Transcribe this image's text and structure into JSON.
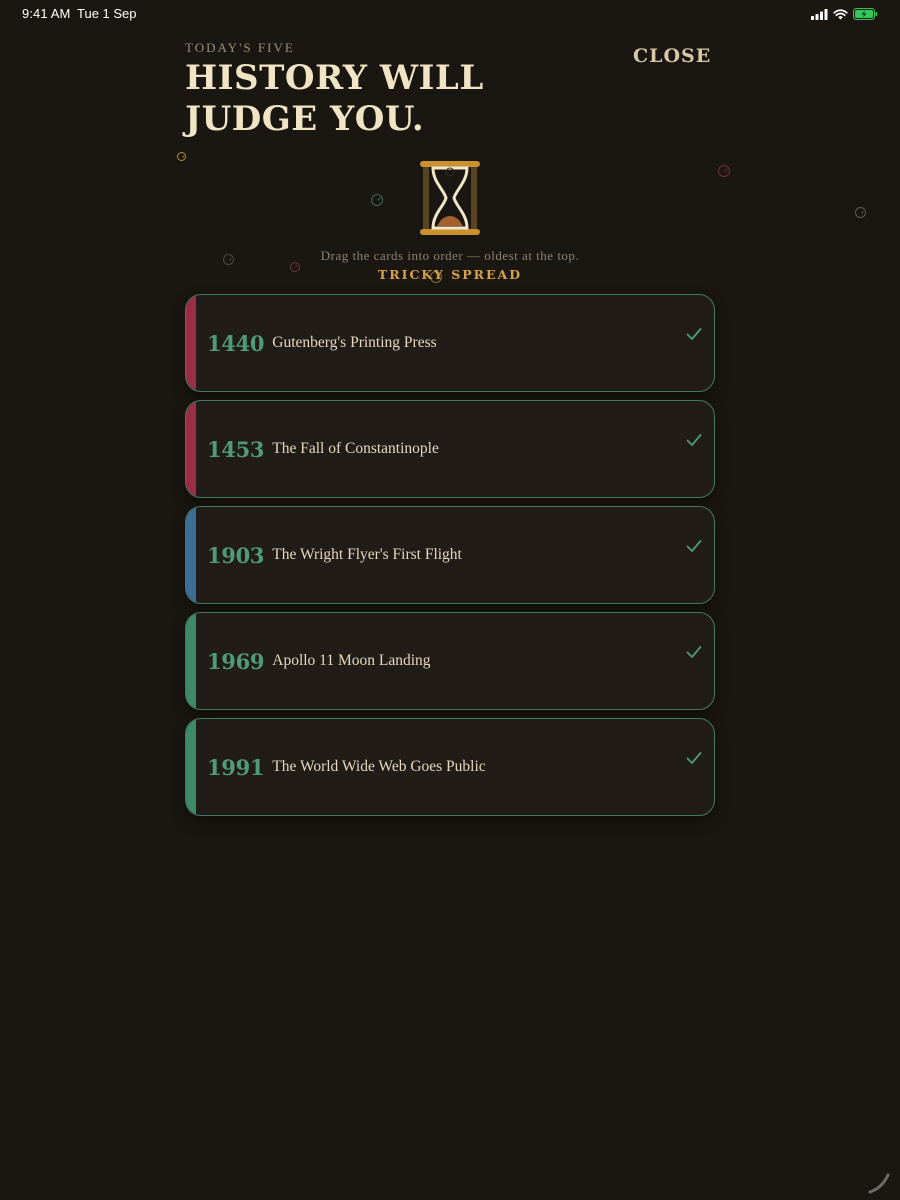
{
  "status_bar": {
    "time": "9:41 AM",
    "date": "Tue 1 Sep"
  },
  "header": {
    "eyebrow": "TODAY'S FIVE",
    "title": "HISTORY WILL JUDGE YOU.",
    "close_label": "CLOSE"
  },
  "instructions": "Drag the cards into order — oldest at the top.",
  "difficulty": "TRICKY SPREAD",
  "colors": {
    "background": "#1a1611",
    "card_border": "#3f7b64",
    "year_text": "#4f9a7a",
    "accent_gold": "#d7a24a"
  },
  "cards": [
    {
      "year": "1440",
      "title": "Gutenberg's Printing Press",
      "stripe_color": "#9b2e45",
      "status_icon": "check-icon"
    },
    {
      "year": "1453",
      "title": "The Fall of Constantinople",
      "stripe_color": "#9b2e45",
      "status_icon": "check-icon"
    },
    {
      "year": "1903",
      "title": "The Wright Flyer's First Flight",
      "stripe_color": "#3d6f96",
      "status_icon": "check-icon"
    },
    {
      "year": "1969",
      "title": "Apollo 11 Moon Landing",
      "stripe_color": "#3e8a66",
      "status_icon": "check-icon"
    },
    {
      "year": "1991",
      "title": "The World Wide Web Goes Public",
      "stripe_color": "#3e8a66",
      "status_icon": "check-icon"
    }
  ]
}
